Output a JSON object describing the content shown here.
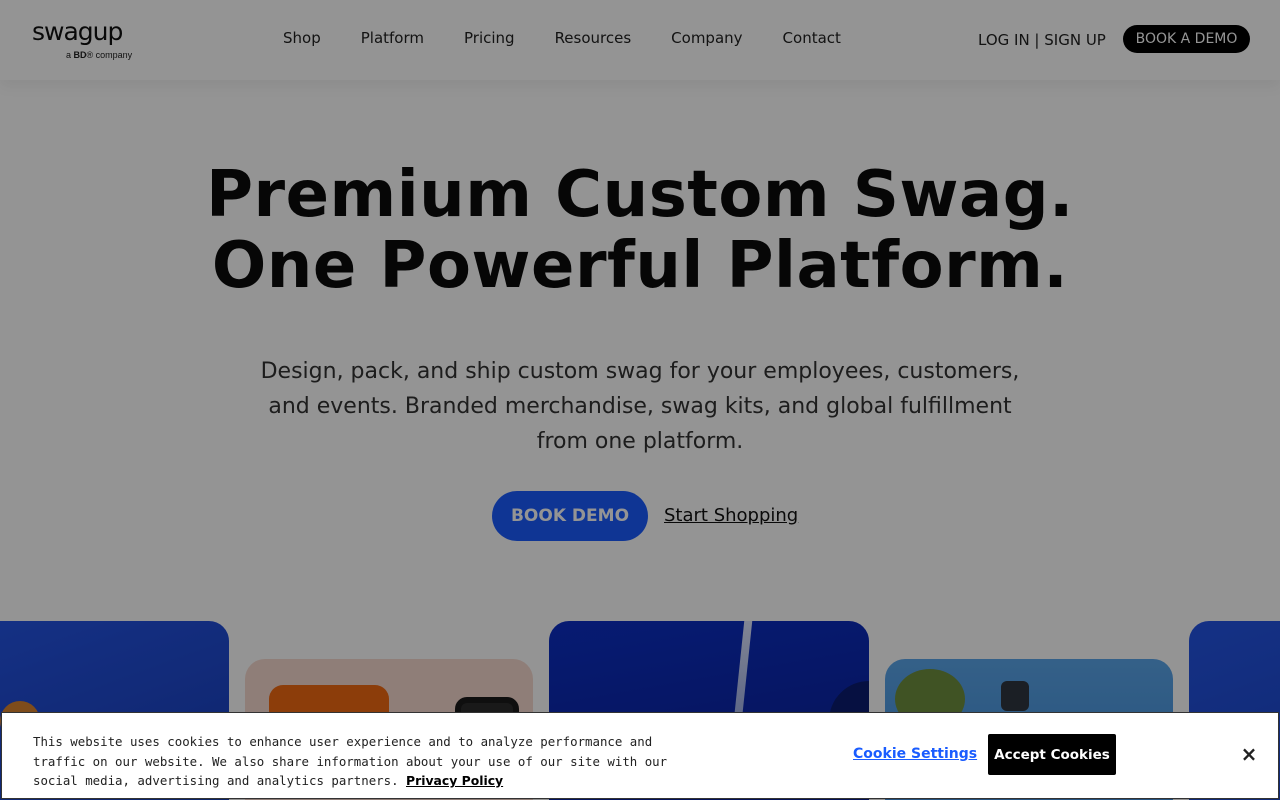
{
  "brand": {
    "logo_text": "swagup",
    "logo_sub_prefix": "a",
    "logo_sub_brand": "BD",
    "logo_sub_suffix": "® company"
  },
  "nav": {
    "items": [
      "Shop",
      "Platform",
      "Pricing",
      "Resources",
      "Company",
      "Contact"
    ],
    "auth_label": "LOG IN | SIGN UP",
    "demo_label": "BOOK A DEMO"
  },
  "hero": {
    "title_line1": "Premium Custom Swag.",
    "title_line2": "One Powerful Platform.",
    "subtitle": "Design, pack, and ship custom swag for your employees, customers, and events. Branded merchandise, swag kits, and global fulfillment from one platform.",
    "cta_label": "BOOK DEMO",
    "shop_label": "Start Shopping"
  },
  "cookie": {
    "text": "This website uses cookies to enhance user experience and to analyze performance and traffic on our website. We also share information about your use of our site with our social media, advertising and analytics partners.",
    "policy_label": "Privacy Policy",
    "settings_label": "Cookie Settings",
    "accept_label": "Accept Cookies",
    "close_label": "×"
  },
  "colors": {
    "accent_blue": "#1a5cff",
    "overlay": "rgba(0,0,0,0.42)"
  }
}
